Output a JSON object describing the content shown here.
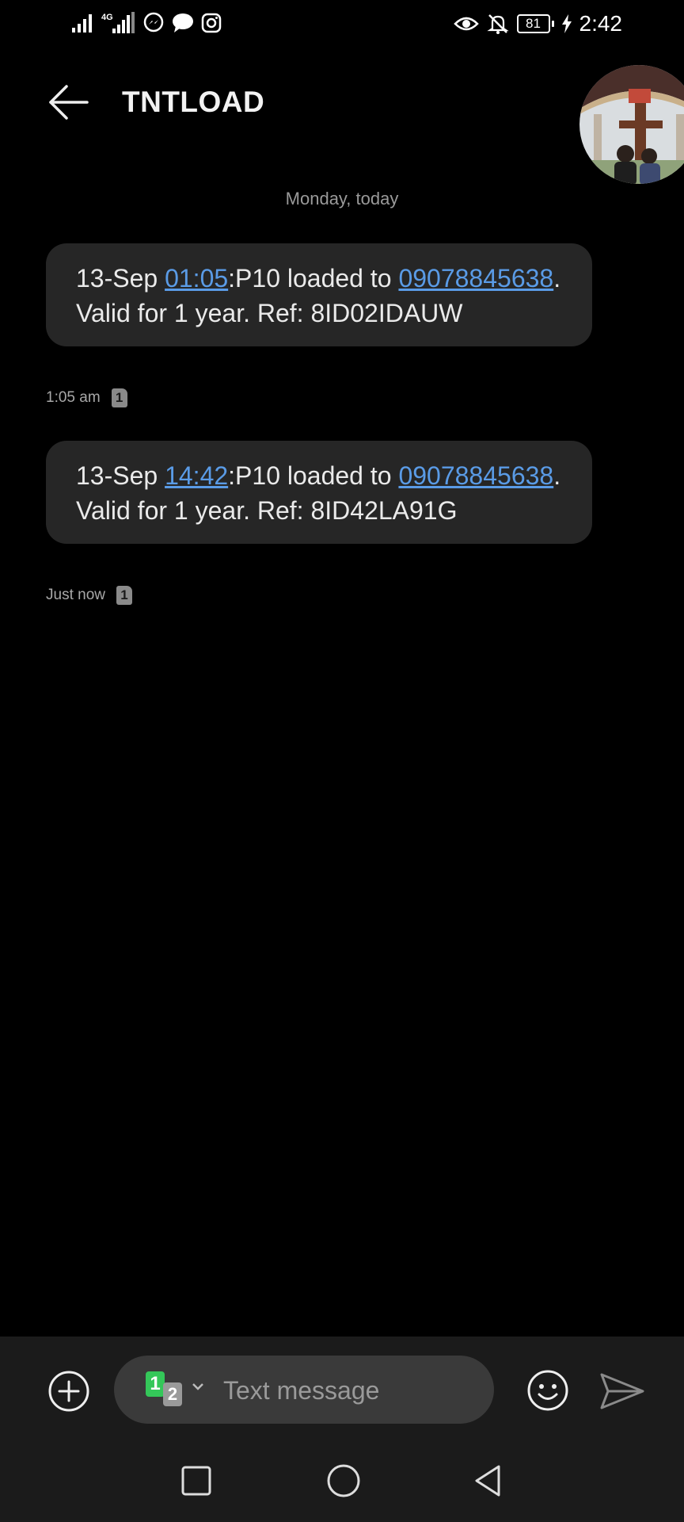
{
  "status_bar": {
    "network_label": "4G",
    "battery_level": "81",
    "time": "2:42",
    "icons": [
      "signal-icon",
      "signal-4g-icon",
      "messenger-icon",
      "chat-bubble-icon",
      "instagram-icon",
      "eye-icon",
      "bell-off-icon",
      "battery-icon",
      "charging-icon"
    ]
  },
  "header": {
    "contact_name": "TNTLOAD",
    "back_icon": "arrow-left-icon"
  },
  "conversation": {
    "date_divider": "Monday, today",
    "messages": [
      {
        "prefix": "13-Sep ",
        "time_link": "01:05",
        "mid_text": ":P10 loaded to ",
        "phone_link": "09078845638",
        "tail_text": ". Valid for 1 year. Ref: 8ID02IDAUW",
        "timestamp": "1:05 am",
        "sim": "1"
      },
      {
        "prefix": "13-Sep ",
        "time_link": "14:42",
        "mid_text": ":P10 loaded to ",
        "phone_link": "09078845638",
        "tail_text": ". Valid for 1 year. Ref: 8ID42LA91G",
        "timestamp": "Just now",
        "sim": "1"
      }
    ]
  },
  "compose": {
    "placeholder": "Text message",
    "sim_primary": "1",
    "sim_secondary": "2"
  },
  "colors": {
    "background": "#000000",
    "bubble": "#262626",
    "link": "#5a9be6",
    "compose_bar": "#1b1b1b",
    "sim1_green": "#34c759"
  }
}
